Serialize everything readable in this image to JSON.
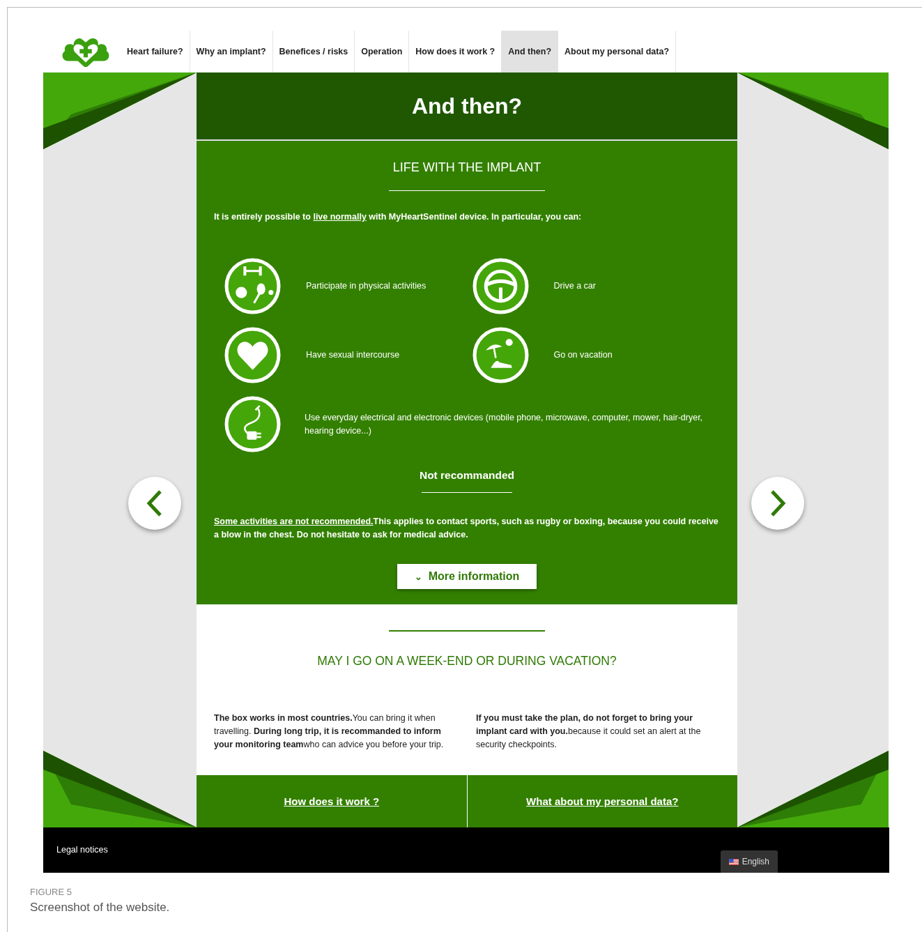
{
  "nav": {
    "items": [
      {
        "label": "Heart failure?",
        "selected": false
      },
      {
        "label": "Why an implant?",
        "selected": false
      },
      {
        "label": "Benefices / risks",
        "selected": false
      },
      {
        "label": "Operation",
        "selected": false
      },
      {
        "label": "How does it work ?",
        "selected": false
      },
      {
        "label": "And then?",
        "selected": true
      },
      {
        "label": "About my personal data?",
        "selected": false
      }
    ]
  },
  "page_title": "And then?",
  "life_section": {
    "heading": "LIFE WITH THE IMPLANT",
    "intro": {
      "before": "It is entirely possible to ",
      "link": "live normally",
      "after": " with MyHeartSentinel device. In particular, you can:"
    },
    "feature_rows": [
      [
        {
          "kind": "fitness",
          "text": "Participate in physical activities"
        },
        {
          "kind": "car",
          "text": "Drive a car"
        }
      ],
      [
        {
          "kind": "heart",
          "text": "Have sexual intercourse"
        },
        {
          "kind": "vacation",
          "text": "Go on vacation"
        }
      ],
      [
        {
          "kind": "plug",
          "text": "Use everyday electrical and electronic devices (mobile phone, microwave, computer, mower, hair-dryer, hearing device...)"
        }
      ]
    ],
    "subheading": "Not recommanded",
    "warning": {
      "link": "Some activities are not recommended.",
      "after": "This applies to contact sports, such as rugby or boxing, because you could receive a blow in the chest. Do not hesitate to ask for medical advice."
    },
    "button": {
      "icon": "⌄",
      "label": "More information"
    }
  },
  "vacation_section": {
    "heading": "MAY I GO ON A WEEK-END OR DURING VACATION?",
    "paragraphs": [
      "**The box works in most countries.**You can bring it when travelling. **During long trip, it is recommanded to inform your monitoring team**who can advice you before your trip.",
      "**If you must take the plan, do not forget to bring your implant card with you.**because it could set an alert at the security checkpoints."
    ]
  },
  "bottom_links": [
    "How does it work ?",
    "What about my personal data?"
  ],
  "footer": {
    "link": "Legal notices",
    "language": "English"
  },
  "caption": {
    "label": "FIGURE 5",
    "text": "Screenshot of the website."
  }
}
